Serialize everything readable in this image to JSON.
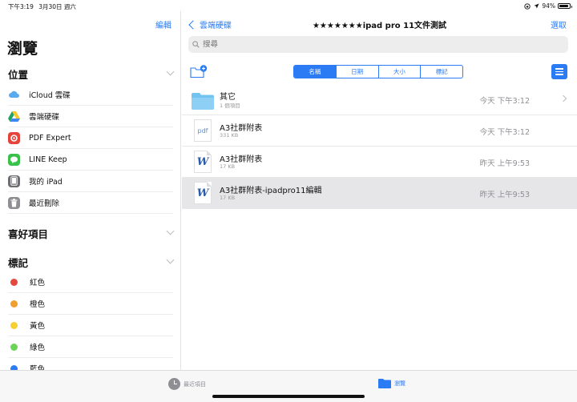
{
  "status": {
    "time": "下午3:19",
    "date": "3月30日 週六",
    "battery": "94%",
    "battery_level": 0.94
  },
  "sidebar": {
    "edit_label": "編輯",
    "title": "瀏覽",
    "locations_header": "位置",
    "locations": [
      {
        "label": "iCloud 雲碟",
        "icon": "icloud-icon"
      },
      {
        "label": "雲端硬碟",
        "icon": "google-drive-icon"
      },
      {
        "label": "PDF Expert",
        "icon": "pdf-expert-icon"
      },
      {
        "label": "LINE Keep",
        "icon": "line-icon"
      },
      {
        "label": "我的 iPad",
        "icon": "ipad-icon"
      },
      {
        "label": "最近刪除",
        "icon": "trash-icon"
      }
    ],
    "favorites_header": "喜好項目",
    "tags_header": "標記",
    "tags": [
      {
        "label": "紅色",
        "color": "#e5483f"
      },
      {
        "label": "橙色",
        "color": "#f0a030"
      },
      {
        "label": "黃色",
        "color": "#f5d031"
      },
      {
        "label": "綠色",
        "color": "#6cd35a"
      },
      {
        "label": "藍色",
        "color": "#2a7bf4"
      }
    ]
  },
  "main": {
    "back_label": "雲端硬碟",
    "title": "★★★★★★★ipad pro 11文件測試",
    "select_label": "選取",
    "search_placeholder": "搜尋",
    "sort_options": [
      "名稱",
      "日期",
      "大小",
      "標記"
    ],
    "sort_active": 0,
    "files": [
      {
        "name": "其它",
        "sub": "1 個項目",
        "date": "今天 下午3:12",
        "type": "folder"
      },
      {
        "name": "A3社群附表",
        "sub": "331 KB",
        "date": "今天 下午3:12",
        "type": "pdf",
        "type_label": "pdf"
      },
      {
        "name": "A3社群附表",
        "sub": "17 KB",
        "date": "昨天 上午9:53",
        "type": "word",
        "type_label": "W"
      },
      {
        "name": "A3社群附表-ipadpro11編輯",
        "sub": "17 KB",
        "date": "昨天 上午9:53",
        "type": "word",
        "type_label": "W"
      }
    ]
  },
  "tabbar": {
    "recent_label": "最近項目",
    "browse_label": "瀏覽"
  },
  "colors": {
    "accent": "#2a7bf4"
  }
}
